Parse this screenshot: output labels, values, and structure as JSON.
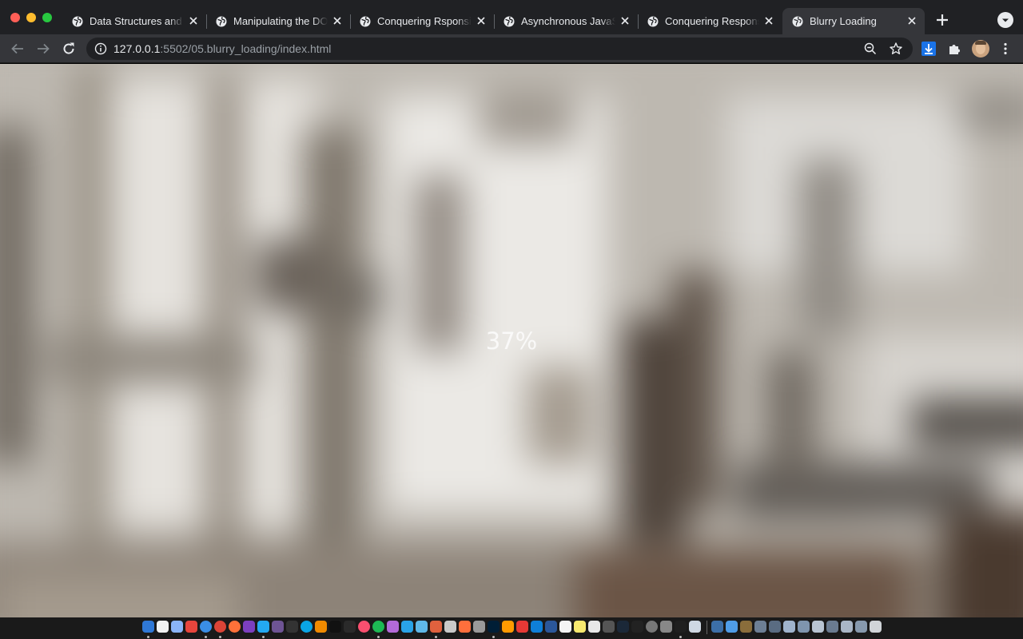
{
  "browser": {
    "tabs": [
      {
        "title": "Data Structures and",
        "active": false
      },
      {
        "title": "Manipulating the DO",
        "active": false
      },
      {
        "title": "Conquering Rsponsi",
        "active": false
      },
      {
        "title": "Asynchronous JavaS",
        "active": false
      },
      {
        "title": "Conquering Respons",
        "active": false
      },
      {
        "title": "Blurry Loading",
        "active": true
      }
    ],
    "address_bar": {
      "host": "127.0.0.1",
      "path": ":5502/05.blurry_loading/index.html"
    }
  },
  "page": {
    "loading_text": "37%",
    "loading_progress_percent": 37
  },
  "colors": {
    "tabstrip": "#202124",
    "toolbar": "#35363a",
    "omnibox": "#202124",
    "tab_text": "#e8eaed",
    "loading_text": "#ffffff"
  },
  "icons": {
    "tab": "globe-icon",
    "tab_close": "close-icon",
    "nav": [
      "back-arrow-icon",
      "forward-arrow-icon",
      "reload-icon"
    ],
    "omnibox": [
      "info-icon",
      "zoom-out-icon",
      "star-icon"
    ],
    "toolbar": [
      "download-icon",
      "extensions-puzzle-icon",
      "profile-avatar",
      "more-vert-icon"
    ]
  }
}
